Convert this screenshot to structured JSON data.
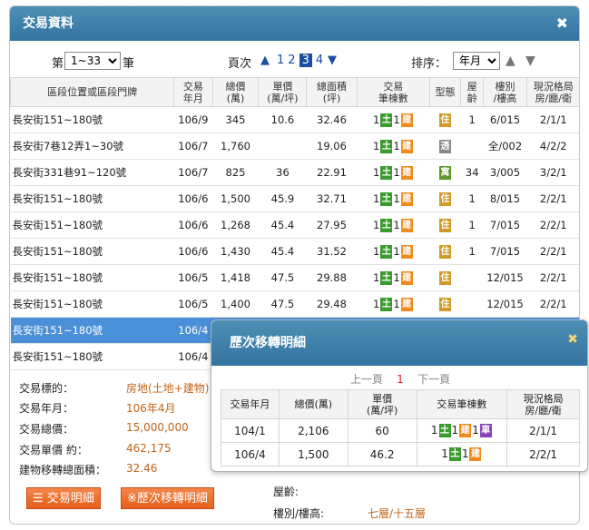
{
  "window": {
    "title": "交易資料",
    "close": "✖"
  },
  "controls": {
    "range_prefix": "第",
    "range_value": "1~33",
    "range_suffix": "筆",
    "page_label": "頁次",
    "up_arrow": "▲",
    "down_arrow": "▼",
    "pages": [
      "1",
      "2",
      "3",
      "4"
    ],
    "current_page": "3",
    "sort_label": "排序：",
    "sort_value": "年月",
    "sort_up": "▲",
    "sort_down": "▼"
  },
  "table": {
    "headers": [
      "區段位置或區段門牌",
      "交易\n年月",
      "總價\n(萬)",
      "單價\n(萬/坪)",
      "總面積\n(坪)",
      "交易\n筆棟數",
      "型態",
      "屋\n齡",
      "樓別\n/樓高",
      "現況格局\n房/廳/衛"
    ],
    "rows": [
      {
        "addr": "長安街151~180號",
        "ym": "106/9",
        "total": "345",
        "unit": "10.6",
        "area": "32.46",
        "land": "1",
        "build": "1",
        "type": "住",
        "age": "1",
        "floor": "6/015",
        "layout": "2/1/1"
      },
      {
        "addr": "長安街7巷12弄1~30號",
        "ym": "106/7",
        "total": "1,760",
        "unit": "",
        "area": "19.06",
        "land": "1",
        "build": "1",
        "type": "透",
        "age": "",
        "floor": "全/002",
        "layout": "4/2/2"
      },
      {
        "addr": "長安街331巷91~120號",
        "ym": "106/7",
        "total": "825",
        "unit": "36",
        "area": "22.91",
        "land": "1",
        "build": "1",
        "type": "寓",
        "age": "34",
        "floor": "3/005",
        "layout": "3/2/1"
      },
      {
        "addr": "長安街151~180號",
        "ym": "106/6",
        "total": "1,500",
        "unit": "45.9",
        "area": "32.71",
        "land": "1",
        "build": "1",
        "type": "住",
        "age": "1",
        "floor": "8/015",
        "layout": "2/2/1"
      },
      {
        "addr": "長安街151~180號",
        "ym": "106/6",
        "total": "1,268",
        "unit": "45.4",
        "area": "27.95",
        "land": "1",
        "build": "1",
        "type": "住",
        "age": "1",
        "floor": "7/015",
        "layout": "2/2/1"
      },
      {
        "addr": "長安街151~180號",
        "ym": "106/6",
        "total": "1,430",
        "unit": "45.4",
        "area": "31.52",
        "land": "1",
        "build": "1",
        "type": "住",
        "age": "1",
        "floor": "7/015",
        "layout": "2/2/1"
      },
      {
        "addr": "長安街151~180號",
        "ym": "106/5",
        "total": "1,418",
        "unit": "47.5",
        "area": "29.88",
        "land": "1",
        "build": "1",
        "type": "住",
        "age": "",
        "floor": "12/015",
        "layout": "2/2/1"
      },
      {
        "addr": "長安街151~180號",
        "ym": "106/5",
        "total": "1,400",
        "unit": "47.5",
        "area": "29.48",
        "land": "1",
        "build": "1",
        "type": "住",
        "age": "",
        "floor": "12/015",
        "layout": "2/2/1"
      },
      {
        "addr": "長安街151~180號",
        "ym": "106/4",
        "total": "",
        "unit": "",
        "area": "",
        "land": "",
        "build": "",
        "type": "",
        "age": "",
        "floor": "",
        "layout": ""
      },
      {
        "addr": "長安街151~180號",
        "ym": "106/4",
        "total": "",
        "unit": "",
        "area": "",
        "land": "",
        "build": "",
        "type": "",
        "age": "",
        "floor": "",
        "layout": ""
      }
    ],
    "badges": {
      "land": "土",
      "build": "建",
      "car": "車"
    }
  },
  "detail": {
    "labels": [
      "交易標的：",
      "交易年月：",
      "交易總價：",
      "交易單價 約：",
      "建物移轉總面積："
    ],
    "values": [
      "房地(土地+建物)",
      "106年4月",
      "15,000,000",
      "462,175",
      "32.46"
    ],
    "right_labels": [
      "屋齡:",
      "樓別/樓高:"
    ],
    "right_values": [
      "",
      "七層/十五層"
    ],
    "btn_detail": "交易明細",
    "btn_history": "※歷次移轉明細"
  },
  "dialog": {
    "title": "歷次移轉明細",
    "close": "✖",
    "prev": "上一頁",
    "page": "1",
    "next": "下一頁",
    "headers": [
      "交易年月",
      "總價(萬)",
      "單價\n(萬/坪)",
      "交易筆棟數",
      "現況格局\n房/廳/衛"
    ],
    "rows": [
      {
        "ym": "104/1",
        "total": "2,106",
        "unit": "60",
        "land": "1",
        "build": "1",
        "car": "1",
        "layout": "2/1/1"
      },
      {
        "ym": "106/4",
        "total": "1,500",
        "unit": "46.2",
        "land": "1",
        "build": "1",
        "car": "",
        "layout": "2/2/1"
      }
    ]
  }
}
